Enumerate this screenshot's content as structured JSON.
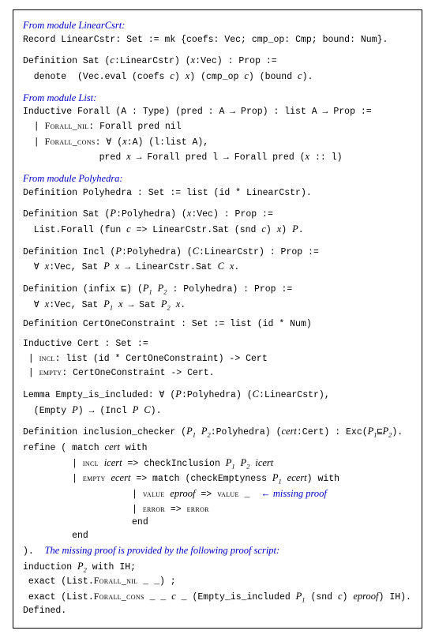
{
  "sec1": {
    "title": "From module LinearCsrt:",
    "l1a": "Record LinearCstr: Set := mk {coefs: Vec; cmp",
    "l1b": "op: Cmp; bound: Num}.",
    "l2a": "Definition Sat (",
    "l2b": ":LinearCstr) (",
    "l2c": ":Vec) : Prop :=",
    "l3a": "  denote  (Vec.eval (coefs ",
    "l3b": ") ",
    "l3c": ") (cmp",
    "l3d": "op ",
    "l3e": ") (bound ",
    "l3f": ")."
  },
  "sec2": {
    "title": "From module List:",
    "l1": "Inductive Forall (A : Type) (pred : A → Prop) : list A → Prop :=",
    "l2a": "  | ",
    "ctor1": "Forall_nil",
    "l2b": ": Forall pred nil",
    "l3a": "  | ",
    "ctor2": "Forall_cons",
    "l3b": ": ∀ (",
    "l3c": ":A) (l:list A),",
    "l4a": "              pred ",
    "l4b": " → Forall pred l → Forall pred (",
    "l4c": " :: l)"
  },
  "sec3": {
    "title": "From module Polyhedra:",
    "l1": "Definition Polyhedra : Set := list (id * LinearCstr).",
    "l2a": "Definition Sat (",
    "l2b": ":Polyhedra) (",
    "l2c": ":Vec) : Prop :=",
    "l3a": "  List.Forall (fun ",
    "l3b": " => LinearCstr.Sat (snd ",
    "l3c": ") ",
    "l3d": ") ",
    "l3e": ".",
    "l4a": "Definition Incl (",
    "l4b": ":Polyhedra) (",
    "l4c": ":LinearCstr) : Prop :=",
    "l5a": "  ∀ ",
    "l5b": ":Vec, Sat ",
    "l5c": " ",
    "l5d": " → LinearCstr.Sat ",
    "l5e": " ",
    "l5f": ".",
    "l6a": "Definition (infix ⊑) (",
    "l6b": " ",
    "l6c": " : Polyhedra) : Prop :=",
    "l7a": "  ∀ ",
    "l7b": ":Vec, Sat ",
    "l7c": " ",
    "l7d": " → Sat ",
    "l7e": " ",
    "l7f": ".",
    "l8": "Definition CertOneConstraint : Set := list (id * Num)",
    "l9": "Inductive Cert : Set :=",
    "l10a": " | ",
    "ctor3": "incl",
    "l10b": ": list (id * CertOneConstraint) -> Cert",
    "l11a": " | ",
    "ctor4": "empty",
    "l11b": ": CertOneConstraint -> Cert.",
    "l12a": "Lemma Empty",
    "l12b": "is",
    "l12c": "included: ∀ (",
    "l12d": ":Polyhedra) (",
    "l12e": ":LinearCstr),",
    "l13a": "  (Empty ",
    "l13b": ") → (Incl ",
    "l13c": " ",
    "l13d": ").",
    "l14a": "Definition inclusion",
    "l14b": "checker (",
    "l14c": " ",
    "l14d": ":Polyhedra) (",
    "l14e": ":Cert) : Exc(",
    "l14f": "⊑",
    "l14g": ").",
    "l15a": "refine ( match ",
    "l15b": " with",
    "l16a": "         | ",
    "ctor5": "incl",
    "l16b": " ",
    "l16c": " => checkInclusion ",
    "l16d": " ",
    "l16e": " ",
    "l17a": "         | ",
    "ctor6": "empty",
    "l17b": " ",
    "l17c": " => match (checkEmptyness ",
    "l17d": " ",
    "l17e": ") with",
    "l18a": "                    | ",
    "ctor7": "value",
    "l18b": " ",
    "l18c": " => ",
    "ctor8": "value",
    "l18d": " _  ",
    "l18comment": "← missing proof",
    "l19a": "                    | ",
    "ctor9": "error",
    "l19b": " => ",
    "ctor10": "error",
    "l20": "                    end",
    "l21": "         end",
    "l22a": ").  ",
    "l22comment": "The missing proof is provided by the following proof script:",
    "l23a": "induction ",
    "l23b": " with IH;",
    "l24a": " exact (List.",
    "ctor11": "Forall_nil",
    "l24b": " _ _) ;",
    "l25a": " exact (List.",
    "ctor12": "Forall_cons",
    "l25b": " _ _ ",
    "l25c": " _ (Empty",
    "l25d": "is",
    "l25e": "included ",
    "l25f": " (snd ",
    "l25g": ") ",
    "l25h": ") IH).",
    "l26": "Defined."
  },
  "vars": {
    "c": "c",
    "x": "x",
    "P": "P",
    "C": "C",
    "P1": "P",
    "P2": "P",
    "cert": "cert",
    "icert": "icert",
    "ecert": "ecert",
    "eproof": "eproof"
  }
}
